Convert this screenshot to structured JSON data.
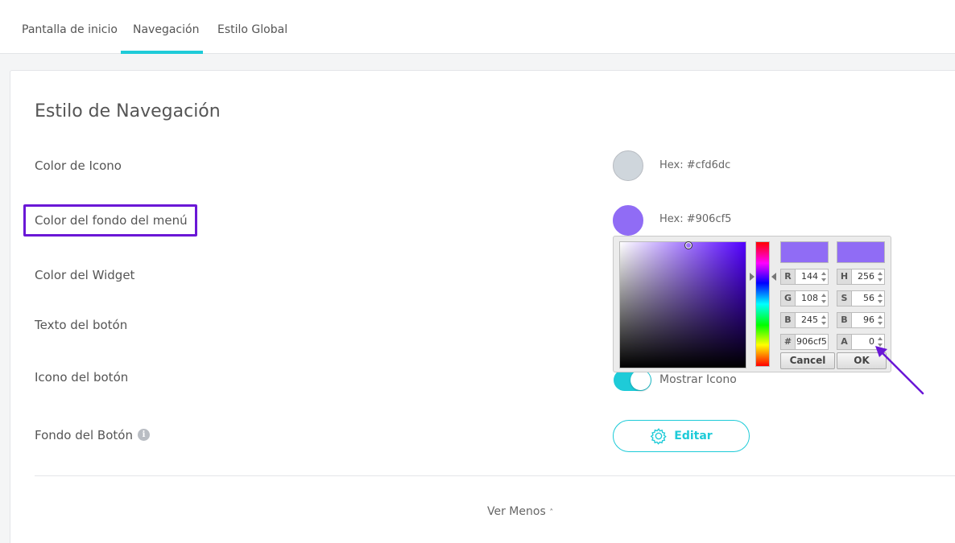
{
  "tabs": [
    {
      "label": "Pantalla de inicio"
    },
    {
      "label": "Navegación"
    },
    {
      "label": "Estilo Global"
    }
  ],
  "section": {
    "title": "Estilo de Navegación"
  },
  "rows": {
    "icon_color": {
      "label": "Color de Icono",
      "hex_text": "Hex: #cfd6dc",
      "color": "#cfd6dc"
    },
    "menu_bg": {
      "label": "Color del fondo del menú",
      "hex_text": "Hex: #906cf5",
      "color": "#906cf5"
    },
    "widget_color": {
      "label": "Color del Widget"
    },
    "button_text": {
      "label": "Texto del botón"
    },
    "button_icon": {
      "label": "Icono del botón",
      "toggle_label": "Mostrar Icono",
      "toggle_on": true
    },
    "button_bg": {
      "label": "Fondo del Botón",
      "info_icon": "info-icon",
      "edit_label": "Editar",
      "edit_icon": "gear-icon"
    }
  },
  "picker": {
    "new_color": "#906cf5",
    "current_color": "#906cf5",
    "fields": {
      "r": {
        "label": "R",
        "value": "144"
      },
      "g": {
        "label": "G",
        "value": "108"
      },
      "b": {
        "label": "B",
        "value": "245"
      },
      "hex": {
        "label": "#",
        "value": "906cf5"
      },
      "h": {
        "label": "H",
        "value": "256"
      },
      "s": {
        "label": "S",
        "value": "56"
      },
      "v": {
        "label": "B",
        "value": "96"
      },
      "a": {
        "label": "A",
        "value": "0"
      }
    },
    "cancel_label": "Cancel",
    "ok_label": "OK"
  },
  "footer": {
    "ver_menos": "Ver Menos"
  },
  "colors": {
    "accent": "#1ecbd8",
    "highlight": "#6a17d6"
  }
}
